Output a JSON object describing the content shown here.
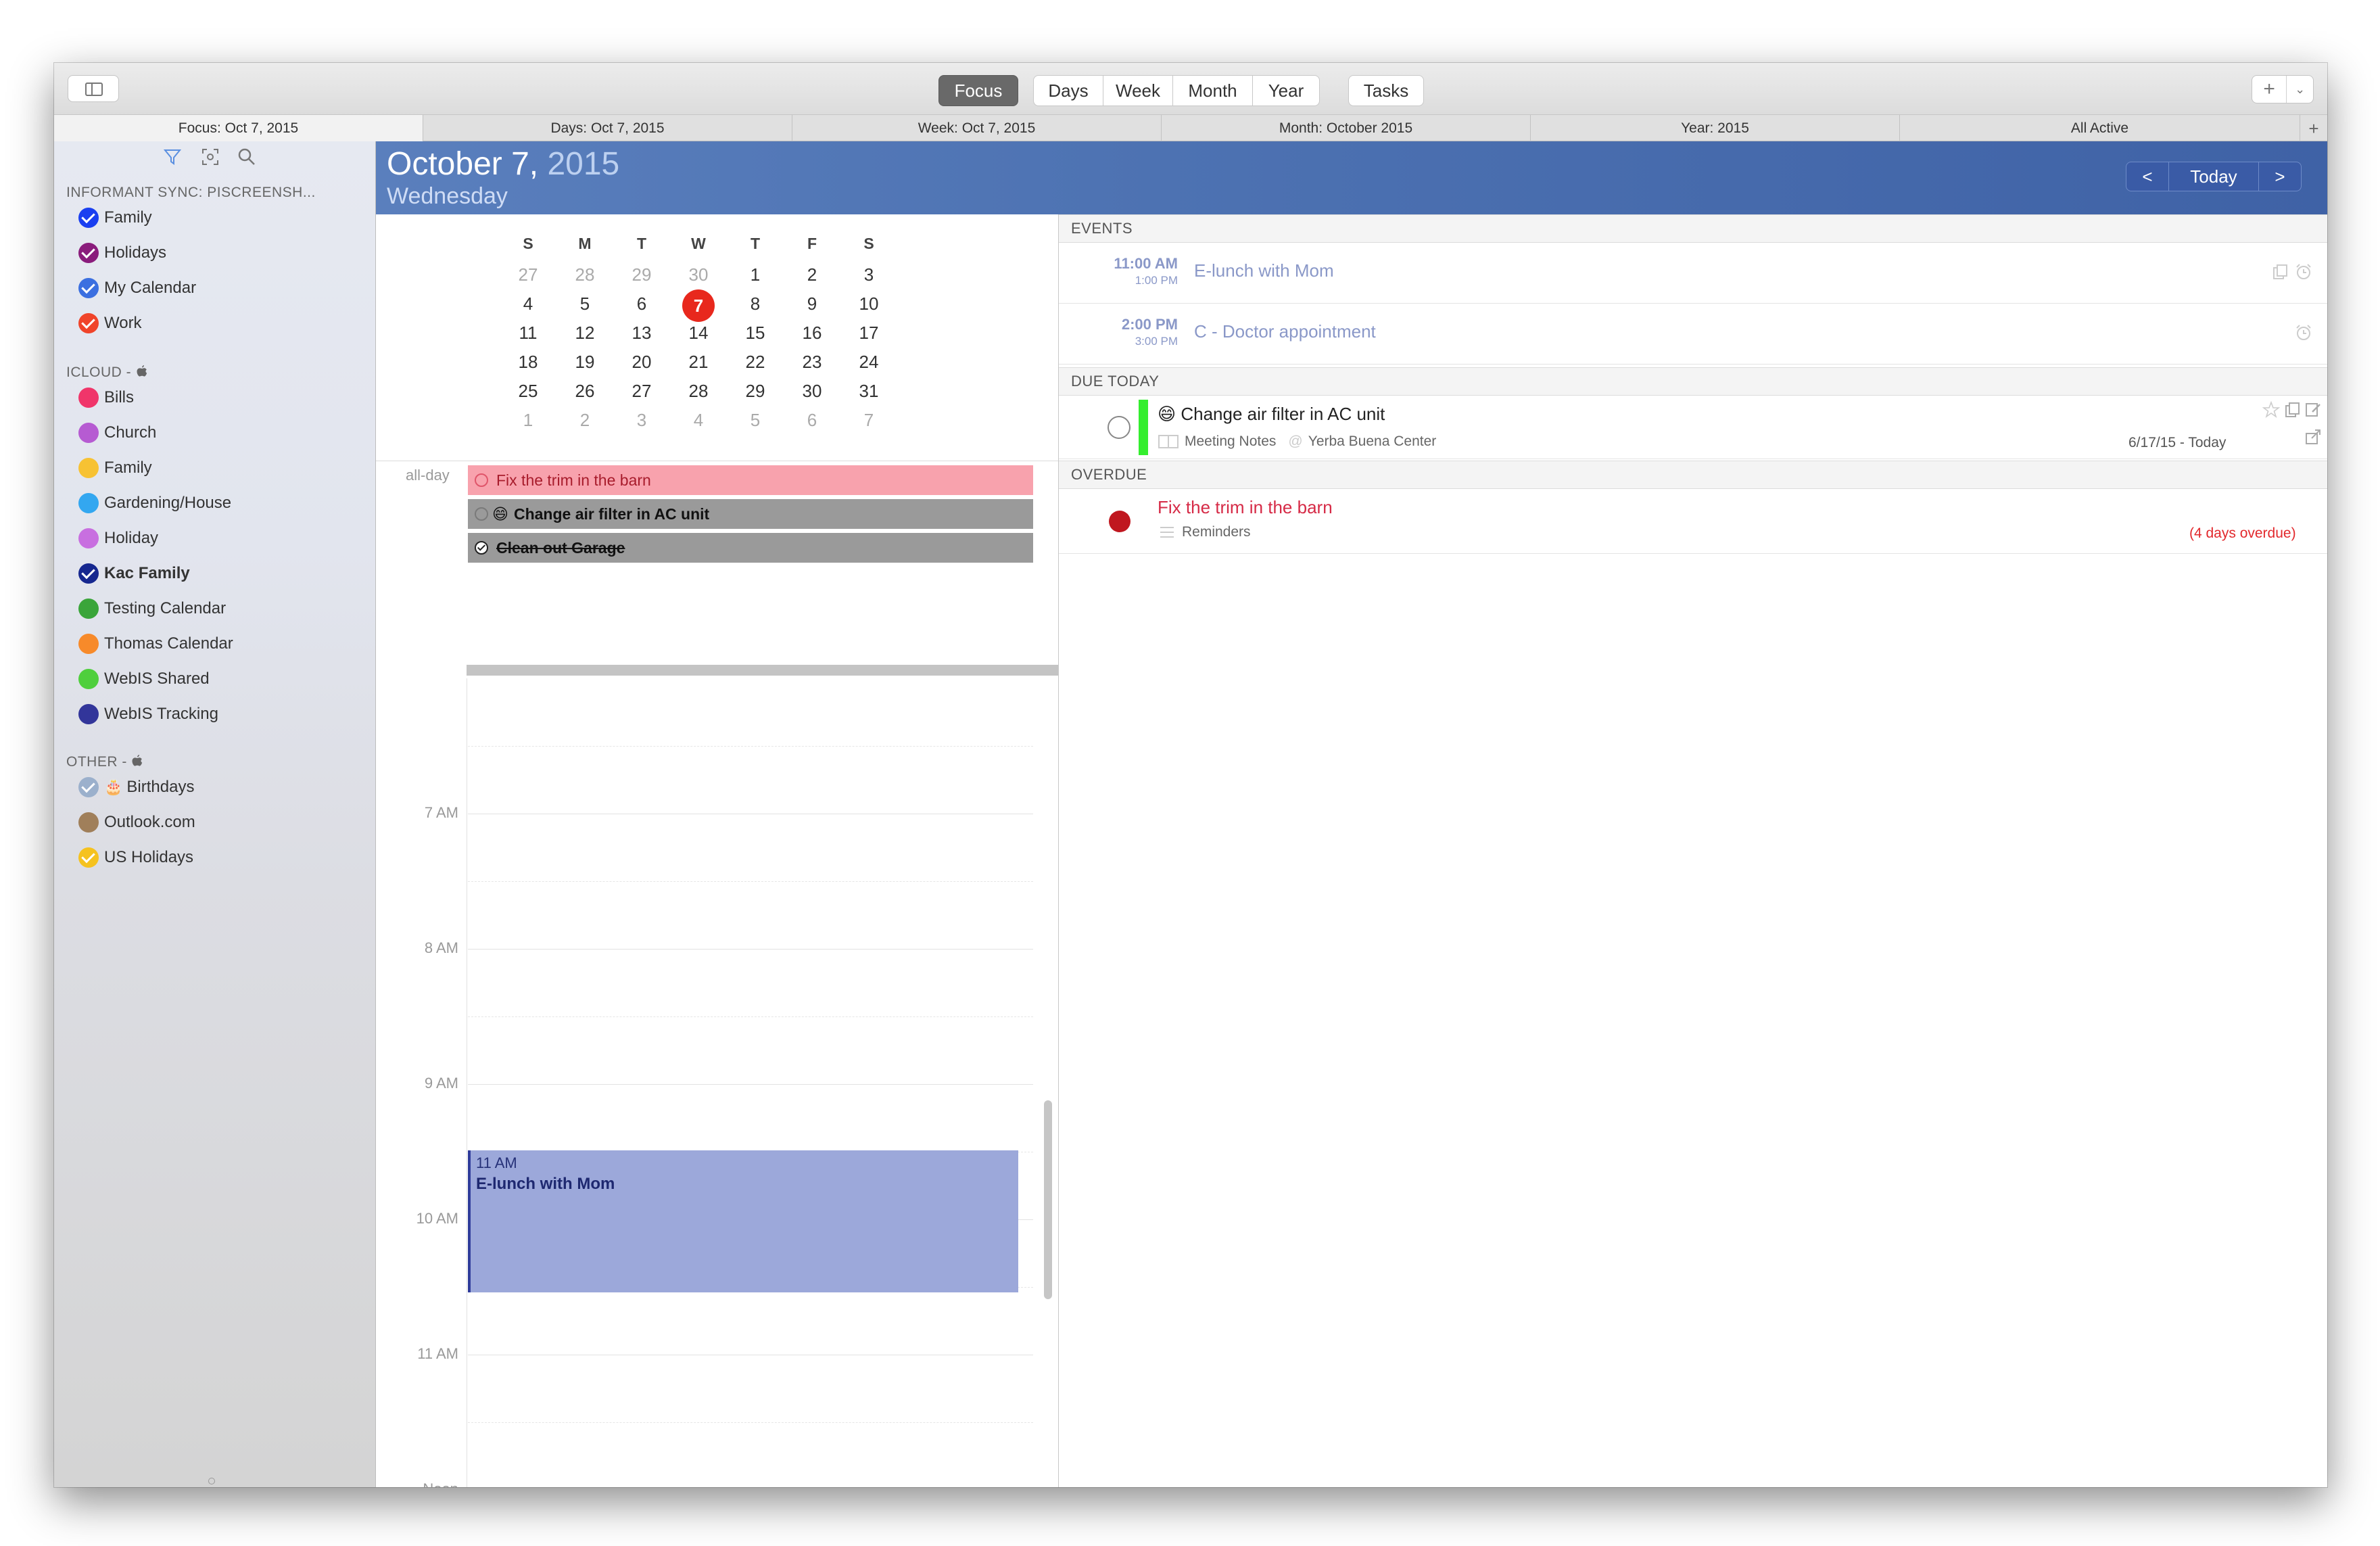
{
  "toolbar": {
    "views": {
      "focus": "Focus",
      "days": "Days",
      "week": "Week",
      "month": "Month",
      "year": "Year",
      "tasks": "Tasks"
    },
    "add_label": "+"
  },
  "tabs": [
    "Focus: Oct 7, 2015",
    "Days: Oct 7, 2015",
    "Week: Oct 7, 2015",
    "Month: October 2015",
    "Year: 2015",
    "All Active"
  ],
  "tab_add": "+",
  "sidebar": {
    "groups": [
      {
        "heading": "INFORMANT SYNC: PISCREENSH...",
        "items": [
          {
            "label": "Family",
            "color": "#1a3ff0",
            "checked": true
          },
          {
            "label": "Holidays",
            "color": "#8a1c7c",
            "checked": true
          },
          {
            "label": "My Calendar",
            "color": "#3b6fe0",
            "checked": true
          },
          {
            "label": "Work",
            "color": "#f0442a",
            "checked": true
          }
        ]
      },
      {
        "heading": "ICLOUD - ",
        "items": [
          {
            "label": "Bills",
            "color": "#f0356a",
            "checked": false
          },
          {
            "label": "Church",
            "color": "#b65bd2",
            "checked": false
          },
          {
            "label": "Family",
            "color": "#f7c233",
            "checked": false
          },
          {
            "label": "Gardening/House",
            "color": "#33a7f0",
            "checked": false
          },
          {
            "label": "Holiday",
            "color": "#c86fe0",
            "checked": false
          },
          {
            "label": "Kac Family",
            "color": "#16278f",
            "checked": true,
            "bold": true
          },
          {
            "label": "Testing Calendar",
            "color": "#3aa53a",
            "checked": false
          },
          {
            "label": "Thomas Calendar",
            "color": "#f78a2a",
            "checked": false
          },
          {
            "label": "WebIS Shared",
            "color": "#4fcf3d",
            "checked": false
          },
          {
            "label": "WebIS Tracking",
            "color": "#32359a",
            "checked": false
          }
        ]
      },
      {
        "heading": "OTHER - ",
        "items": [
          {
            "label": "Birthdays",
            "color": "#9bb0cc",
            "checked": true,
            "emoji": "🎂"
          },
          {
            "label": "Outlook.com",
            "color": "#a07f5a",
            "checked": false
          },
          {
            "label": "US Holidays",
            "color": "#f5c21f",
            "checked": true
          }
        ]
      }
    ]
  },
  "header": {
    "date": "October 7,",
    "year": "2015",
    "weekday": "Wednesday",
    "prev": "<",
    "today": "Today",
    "next": ">"
  },
  "mini_calendar": {
    "weekdays": [
      "S",
      "M",
      "T",
      "W",
      "T",
      "F",
      "S"
    ],
    "weeks": [
      [
        "27",
        "28",
        "29",
        "30",
        "1",
        "2",
        "3"
      ],
      [
        "4",
        "5",
        "6",
        "7",
        "8",
        "9",
        "10"
      ],
      [
        "11",
        "12",
        "13",
        "14",
        "15",
        "16",
        "17"
      ],
      [
        "18",
        "19",
        "20",
        "21",
        "22",
        "23",
        "24"
      ],
      [
        "25",
        "26",
        "27",
        "28",
        "29",
        "30",
        "31"
      ],
      [
        "1",
        "2",
        "3",
        "4",
        "5",
        "6",
        "7"
      ]
    ],
    "today": "7"
  },
  "allday": {
    "label": "all-day",
    "items": [
      {
        "title": "Fix the trim in the barn",
        "style": "pink"
      },
      {
        "title": "Change air filter in AC unit",
        "style": "gray",
        "emoji": "😄"
      },
      {
        "title": "Clean out Garage",
        "style": "gray-done"
      }
    ]
  },
  "timeline": {
    "hours": [
      "7 AM",
      "8 AM",
      "9 AM",
      "10 AM",
      "11 AM",
      "Noon"
    ],
    "event": {
      "time": "11 AM",
      "title": "E-lunch with Mom"
    }
  },
  "events": {
    "heading": "EVENTS",
    "items": [
      {
        "start": "11:00 AM",
        "end": "1:00 PM",
        "title": "E-lunch with Mom"
      },
      {
        "start": "2:00 PM",
        "end": "3:00 PM",
        "title": "C - Doctor appointment"
      }
    ]
  },
  "due_today": {
    "heading": "DUE TODAY",
    "item": {
      "title": "Change air filter in AC unit",
      "emoji": "😄",
      "notes": "Meeting Notes",
      "location": "Yerba Buena Center",
      "dates": "6/17/15 - Today"
    }
  },
  "overdue": {
    "heading": "OVERDUE",
    "item": {
      "title": "Fix the trim in the barn",
      "list": "Reminders",
      "note": "(4 days overdue)"
    }
  }
}
